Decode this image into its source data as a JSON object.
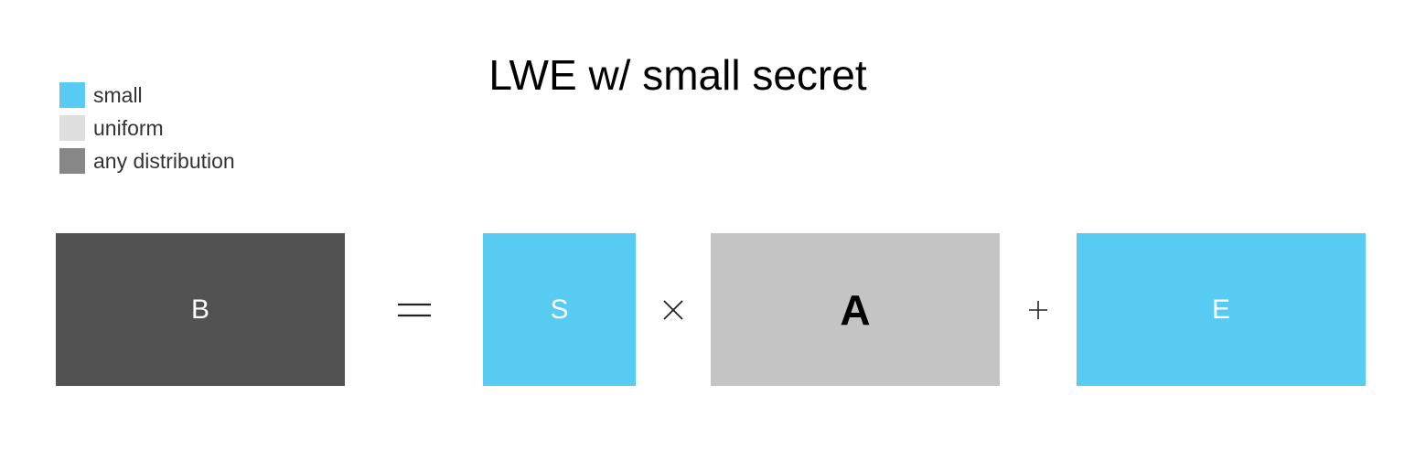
{
  "title": "LWE w/ small secret",
  "legend": [
    {
      "label": "small",
      "color": "#57cbf2"
    },
    {
      "label": "uniform",
      "color": "#dedede"
    },
    {
      "label": "any distribution",
      "color": "#878787"
    }
  ],
  "equation": {
    "blocks": [
      {
        "id": "B",
        "label": "B",
        "fill": "#525252",
        "text_color": "#ffffff"
      },
      {
        "id": "S",
        "label": "S",
        "fill": "#57cbf2",
        "text_color": "#ffffff"
      },
      {
        "id": "A",
        "label": "A",
        "fill": "#c4c4c4",
        "text_color": "#000000"
      },
      {
        "id": "E",
        "label": "E",
        "fill": "#57cbf2",
        "text_color": "#ffffff"
      }
    ],
    "operators": [
      {
        "name": "equals",
        "symbol": "equals-sign"
      },
      {
        "name": "times",
        "symbol": "times-sign"
      },
      {
        "name": "plus",
        "symbol": "plus-sign"
      }
    ]
  }
}
